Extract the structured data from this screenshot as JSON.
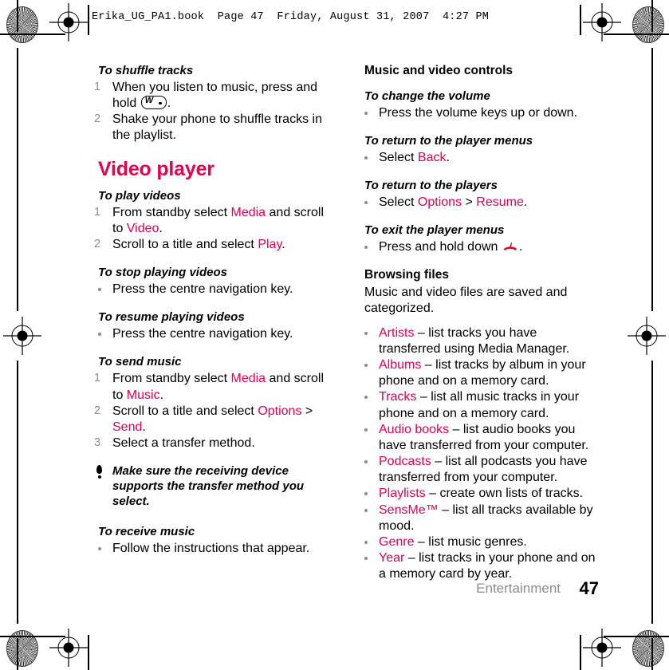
{
  "header": {
    "file_info": "Erika_UG_PA1.book  Page 47  Friday, August 31, 2007  4:27 PM"
  },
  "colors": {
    "accent_pink": "#e2004f",
    "muted_gray": "#8c8c8c",
    "body_black": "#000000"
  },
  "left_column": {
    "shuffle_heading": "To shuffle tracks",
    "shuffle_step1_a": "When you listen to music, press and hold ",
    "shuffle_step1_b": ".",
    "shuffle_step1_num": "1",
    "shuffle_step2": "Shake your phone to shuffle tracks in the playlist.",
    "shuffle_step2_num": "2",
    "video_player_heading": "Video player",
    "play_videos_heading": "To play videos",
    "play_step1_num": "1",
    "play_step1_a": "From standby select ",
    "play_step1_media": "Media",
    "play_step1_b": " and scroll to ",
    "play_step1_video": "Video",
    "play_step1_c": ".",
    "play_step2_num": "2",
    "play_step2_a": "Scroll to a title and select ",
    "play_step2_play": "Play",
    "play_step2_b": ".",
    "stop_heading": "To stop playing videos",
    "stop_bullet": "Press the centre navigation key.",
    "resume_heading": "To resume playing videos",
    "resume_bullet": "Press the centre navigation key.",
    "send_heading": "To send music",
    "send_step1_num": "1",
    "send_step1_a": "From standby select ",
    "send_step1_media": "Media",
    "send_step1_b": " and scroll to ",
    "send_step1_music": "Music",
    "send_step1_c": ".",
    "send_step2_num": "2",
    "send_step2_a": "Scroll to a title and select ",
    "send_step2_options": "Options",
    "send_step2_b": " > ",
    "send_step2_send": "Send",
    "send_step2_c": ".",
    "send_step3_num": "3",
    "send_step3": "Select a transfer method.",
    "tip_text": "Make sure the receiving device supports the transfer method you select.",
    "receive_heading": "To receive music",
    "receive_bullet": "Follow the instructions that appear."
  },
  "right_column": {
    "controls_heading": "Music and video controls",
    "volume_heading": "To change the volume",
    "volume_bullet": "Press the volume keys up or down.",
    "player_menus_heading": "To return to the player menus",
    "player_menus_a": "Select ",
    "player_menus_back": "Back",
    "player_menus_b": ".",
    "players_heading": "To return to the players",
    "players_a": "Select ",
    "players_options": "Options",
    "players_b": " > ",
    "players_resume": "Resume",
    "players_c": ".",
    "exit_heading": "To exit the player menus",
    "exit_a": "Press and hold down ",
    "exit_b": ".",
    "browsing_heading": "Browsing files",
    "browsing_intro": "Music and video files are saved and categorized.",
    "categories": [
      {
        "term": "Artists",
        "desc": " – list tracks you have transferred using Media Manager."
      },
      {
        "term": "Albums",
        "desc": " – list tracks by album in your phone and on a memory card."
      },
      {
        "term": "Tracks",
        "desc": " – list all music tracks in your phone and on a memory card."
      },
      {
        "term": "Audio books",
        "desc": " – list audio books you have transferred from your computer."
      },
      {
        "term": "Podcasts",
        "desc": " – list all podcasts you have transferred from your computer."
      },
      {
        "term": "Playlists",
        "desc": " – create own lists of tracks."
      },
      {
        "term": "SensMe™",
        "desc": " – list all tracks available by mood."
      },
      {
        "term": "Genre",
        "desc": " – list music genres."
      },
      {
        "term": "Year",
        "desc": " – list tracks in your phone and on a memory card by year."
      }
    ]
  },
  "footer": {
    "section": "Entertainment",
    "page_number": "47"
  }
}
